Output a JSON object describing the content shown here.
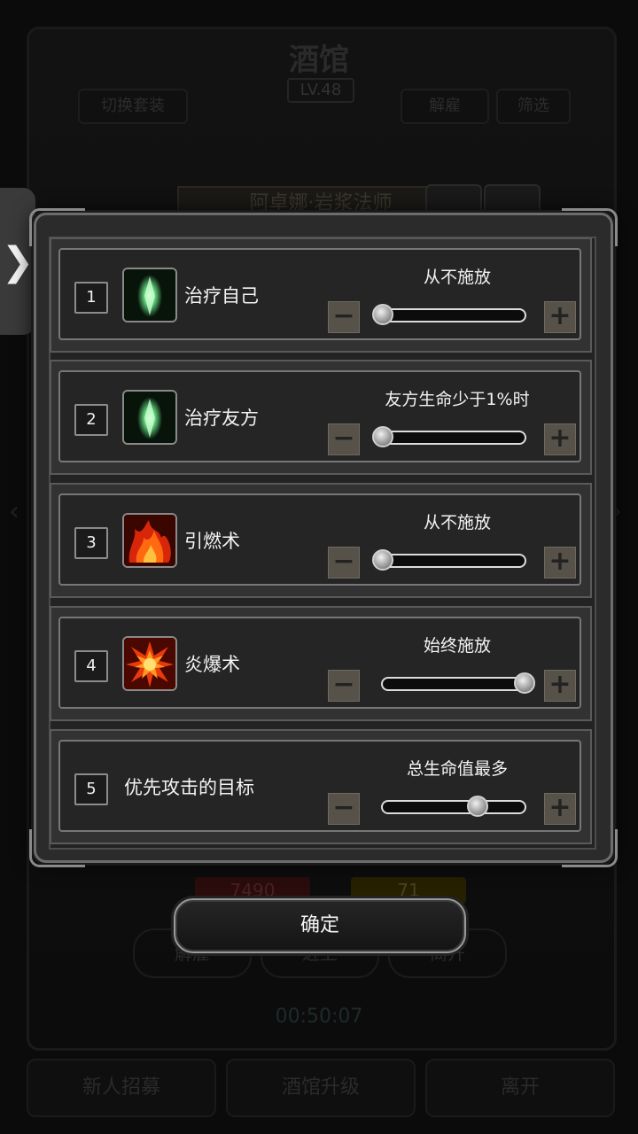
{
  "background": {
    "title": "酒馆",
    "level": "LV.48",
    "switch_outfit": "切换套装",
    "dismiss": "解雇",
    "filter": "筛选",
    "hero_name": "阿卓娜·岩浆法师",
    "hp_value": "7490",
    "mp_value": "71",
    "mid_buttons": [
      "解雇",
      "近卫",
      "离开"
    ],
    "timer": "00:50:07",
    "bottom_buttons": [
      "新人招募",
      "酒馆升级",
      "离开"
    ]
  },
  "side_tab": {
    "glyph": "❯"
  },
  "rules": [
    {
      "index": "1",
      "name": "治疗自己",
      "setting": "从不施放",
      "level": 0,
      "icon": "green-crystal-icon"
    },
    {
      "index": "2",
      "name": "治疗友方",
      "setting": "友方生命少于1%时",
      "level": 0,
      "icon": "green-crystal-icon"
    },
    {
      "index": "3",
      "name": "引燃术",
      "setting": "从不施放",
      "level": 0,
      "icon": "fire-icon"
    },
    {
      "index": "4",
      "name": "炎爆术",
      "setting": "始终施放",
      "level": 1,
      "icon": "explosion-icon"
    },
    {
      "index": "5",
      "name": "优先攻击的目标",
      "setting": "总生命值最多",
      "level": 0.67,
      "icon": ""
    }
  ],
  "stepper": {
    "minus": "−",
    "plus": "+"
  },
  "confirm_label": "确定",
  "colors": {
    "panel": "#2b2b2b",
    "frame": "#777777",
    "stepper": "#56524a"
  }
}
